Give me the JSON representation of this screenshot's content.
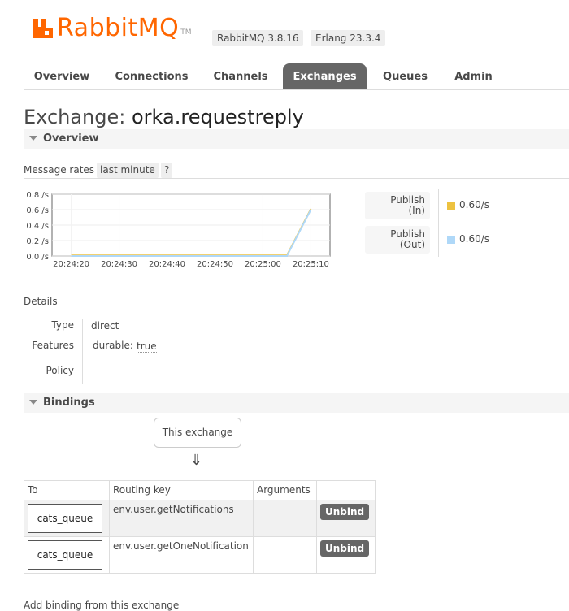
{
  "header": {
    "logo_text": "RabbitMQ",
    "logo_tm": "TM",
    "rabbitmq_version": "RabbitMQ 3.8.16",
    "erlang_version": "Erlang 23.3.4",
    "brand_color": "#ff6600"
  },
  "tabs": [
    {
      "label": "Overview",
      "active": false
    },
    {
      "label": "Connections",
      "active": false
    },
    {
      "label": "Channels",
      "active": false
    },
    {
      "label": "Exchanges",
      "active": true
    },
    {
      "label": "Queues",
      "active": false
    },
    {
      "label": "Admin",
      "active": false
    }
  ],
  "page": {
    "title_prefix": "Exchange:",
    "title_name": "orka.requestreply"
  },
  "overview": {
    "section_label": "Overview",
    "message_rates_label": "Message rates",
    "range_label": "last minute",
    "help_label": "?",
    "publish_in_label_1": "Publish",
    "publish_in_label_2": "(In)",
    "publish_out_label_1": "Publish",
    "publish_out_label_2": "(Out)",
    "publish_in_rate": "0.60/s",
    "publish_out_rate": "0.60/s",
    "publish_in_color": "#edc240",
    "publish_out_color": "#afd8f8"
  },
  "chart_data": {
    "type": "line",
    "x": [
      "20:24:20",
      "20:24:30",
      "20:24:40",
      "20:24:50",
      "20:25:00",
      "20:25:10"
    ],
    "ytick_labels": [
      "0.8 /s",
      "0.6 /s",
      "0.4 /s",
      "0.2 /s",
      "0.0 /s"
    ],
    "ylim": [
      0,
      0.8
    ],
    "series": [
      {
        "name": "Publish (In)",
        "color": "#edc240",
        "points": [
          [
            0,
            0
          ],
          [
            10,
            0
          ],
          [
            20,
            0
          ],
          [
            30,
            0
          ],
          [
            40,
            0
          ],
          [
            45,
            0
          ],
          [
            50,
            0.6
          ]
        ]
      },
      {
        "name": "Publish (Out)",
        "color": "#afd8f8",
        "points": [
          [
            0,
            0
          ],
          [
            10,
            0
          ],
          [
            20,
            0
          ],
          [
            30,
            0
          ],
          [
            40,
            0
          ],
          [
            45,
            0
          ],
          [
            50,
            0.6
          ]
        ]
      }
    ],
    "x_seconds_range": [
      -4,
      54
    ],
    "grid": true
  },
  "details": {
    "section_label": "Details",
    "type_label": "Type",
    "type_value": "direct",
    "features_label": "Features",
    "durable_key": "durable:",
    "durable_value": "true",
    "policy_label": "Policy"
  },
  "bindings": {
    "section_label": "Bindings",
    "this_exchange_label": "This exchange",
    "arrow": "⇓",
    "columns": [
      "To",
      "Routing key",
      "Arguments",
      ""
    ],
    "rows": [
      {
        "to": "cats_queue",
        "routing_key": "env.user.getNotifications",
        "arguments": "",
        "action": "Unbind"
      },
      {
        "to": "cats_queue",
        "routing_key": "env.user.getOneNotification",
        "arguments": "",
        "action": "Unbind"
      }
    ]
  },
  "add_binding_label": "Add binding from this exchange"
}
